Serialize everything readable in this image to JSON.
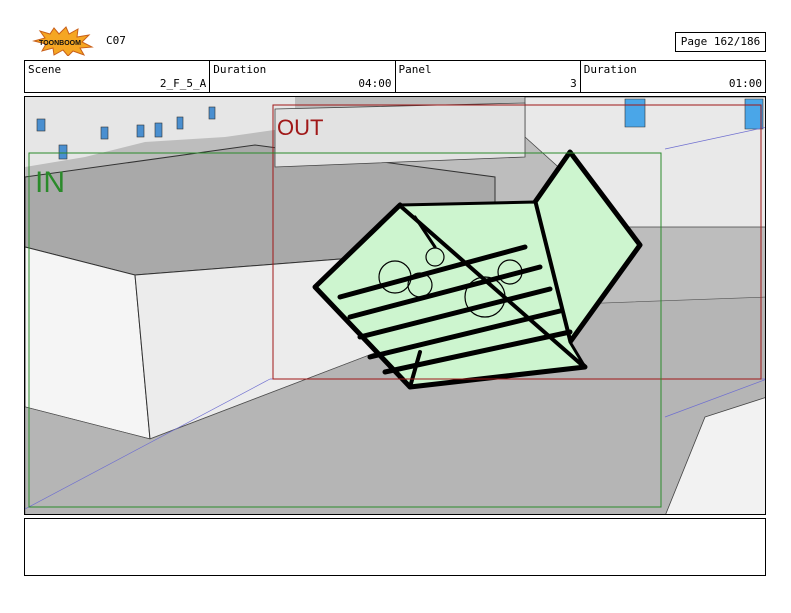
{
  "header": {
    "logo_text": "TOONBOOM",
    "code": "C07",
    "page": "Page 162/186"
  },
  "info": {
    "scene_label": "Scene",
    "scene_value": "2_F_5_A",
    "duration_label": "Duration",
    "duration_value": "04:00",
    "panel_label": "Panel",
    "panel_value": "3",
    "duration2_label": "Duration",
    "duration2_value": "01:00"
  },
  "panel_art": {
    "in_label": "IN",
    "out_label": "OUT",
    "in_color": "#2a8a2a",
    "out_color": "#a01818",
    "crate_fill": "#cdf5cf"
  },
  "notes": {
    "text": ""
  }
}
